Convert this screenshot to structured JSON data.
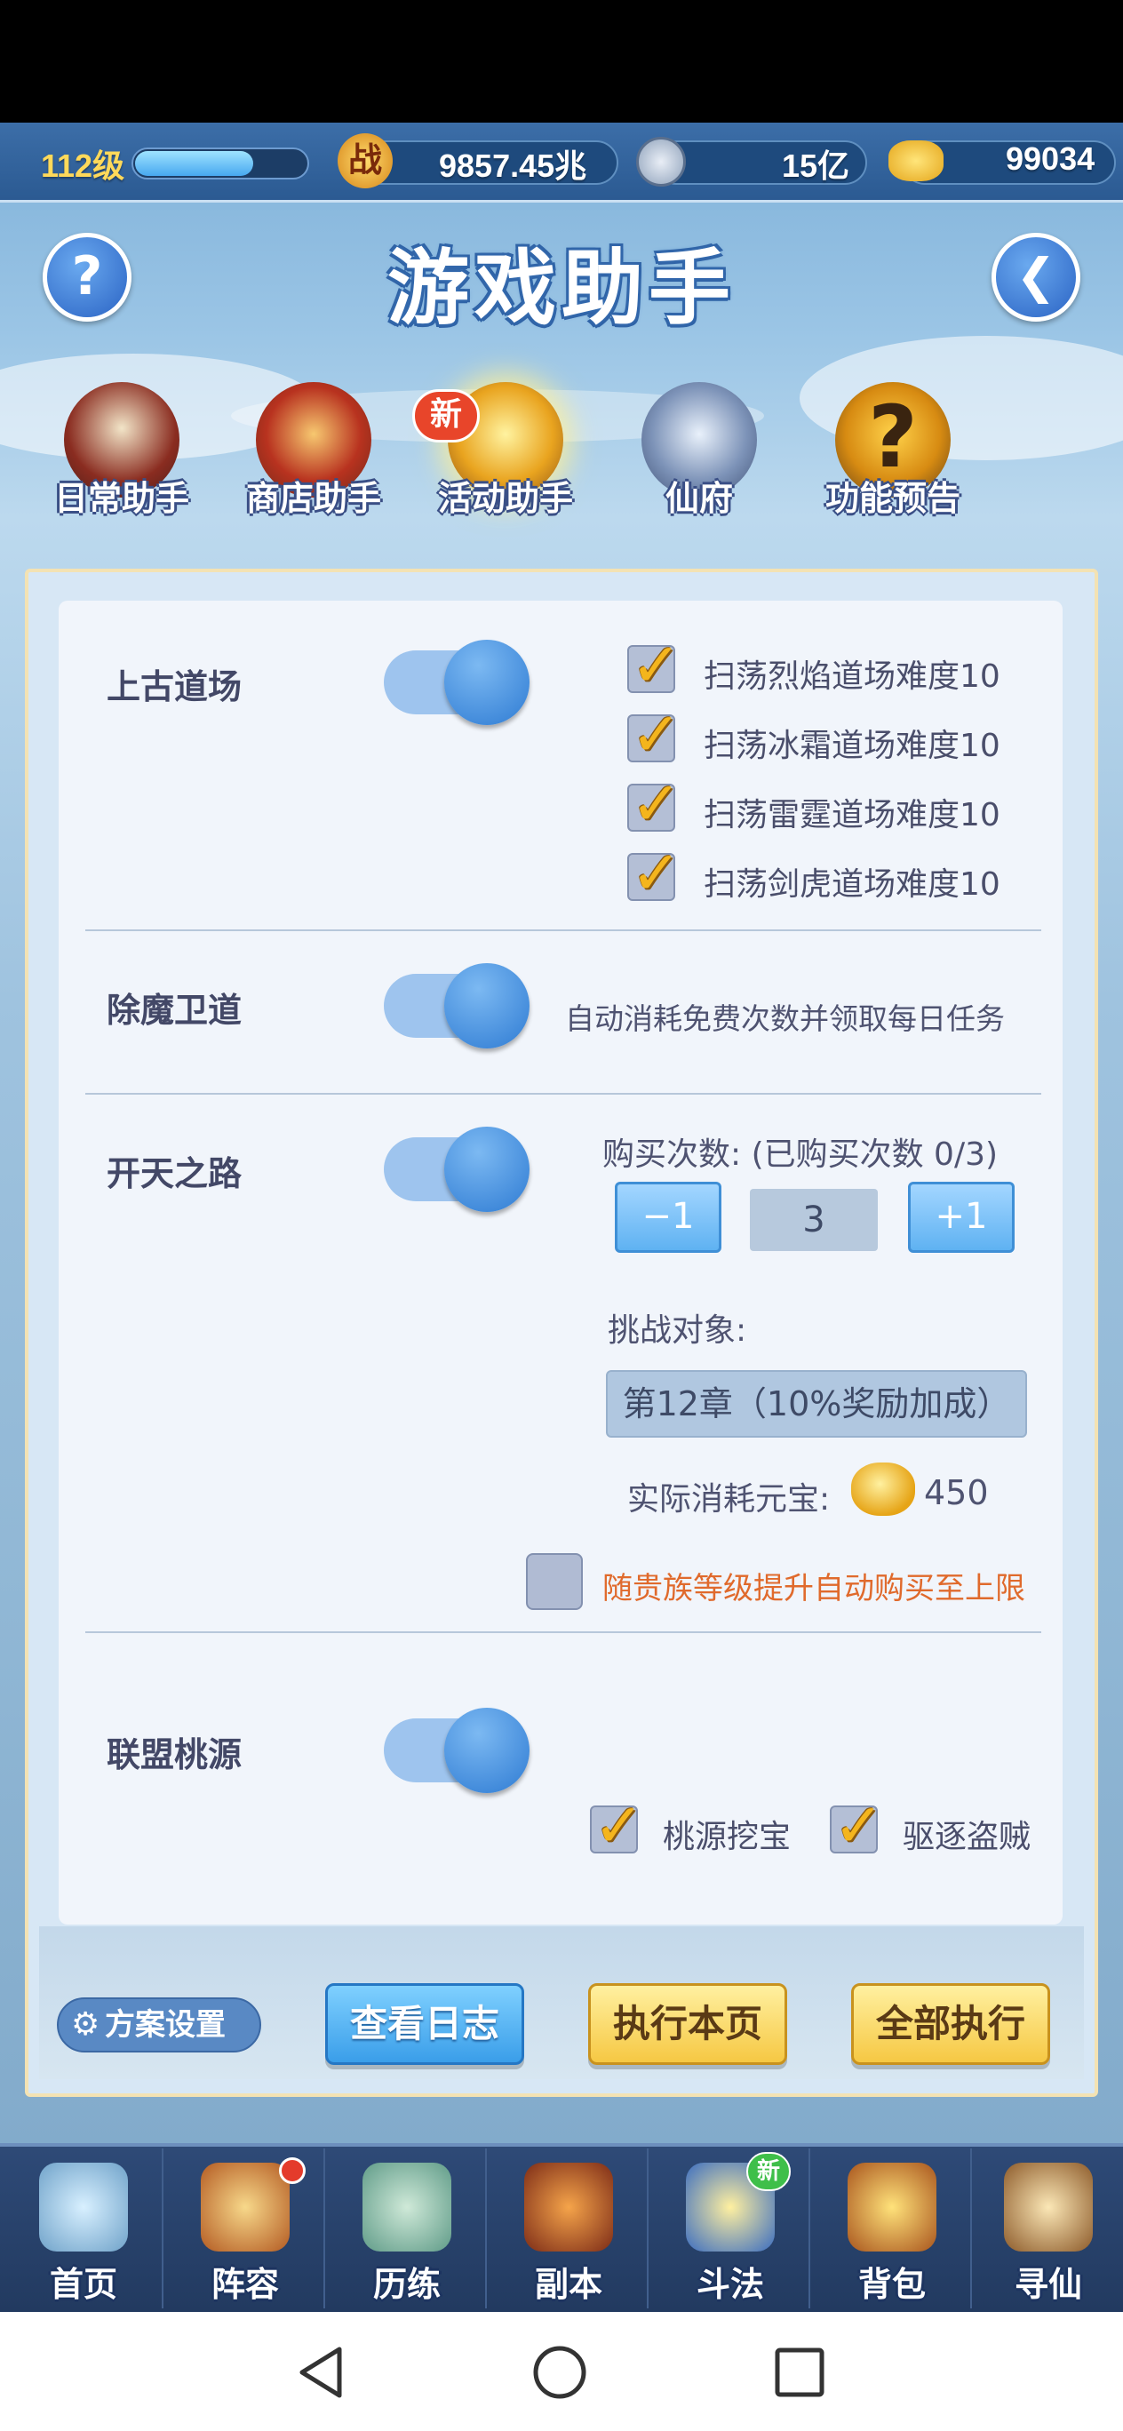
{
  "top_bar": {
    "level": "112级",
    "level_progress": 0.68,
    "power": "9857.45兆",
    "currency": "15亿",
    "gold": "99034"
  },
  "header": {
    "title": "游戏助手",
    "help_icon": "question-icon",
    "back_icon": "back-arrow-icon"
  },
  "tabs": [
    {
      "label": "日常助手",
      "icon": "scroll-icon"
    },
    {
      "label": "商店助手",
      "icon": "shop-icon"
    },
    {
      "label": "活动助手",
      "icon": "treasure-chest-icon",
      "badge": "新",
      "active": true
    },
    {
      "label": "仙府",
      "icon": "palace-icon"
    },
    {
      "label": "功能预告",
      "icon": "question-mark-icon"
    }
  ],
  "sections": {
    "ancient_dojo": {
      "title": "上古道场",
      "enabled": true,
      "options": [
        "扫荡烈焰道场难度10",
        "扫荡冰霜道场难度10",
        "扫荡雷霆道场难度10",
        "扫荡剑虎道场难度10"
      ]
    },
    "demon_guard": {
      "title": "除魔卫道",
      "enabled": true,
      "desc": "自动消耗免费次数并领取每日任务"
    },
    "sky_road": {
      "title": "开天之路",
      "enabled": true,
      "buy_label": "购买次数: (已购买次数 0/3)",
      "minus": "−1",
      "count": "3",
      "plus": "+1",
      "challenge_label": "挑战对象:",
      "challenge_value": "第12章（10%奖励加成）",
      "cost_label": "实际消耗元宝:",
      "cost_value": "450",
      "auto_buy_label": "随贵族等级提升自动购买至上限"
    },
    "alliance_peach": {
      "title": "联盟桃源",
      "enabled": true,
      "options": [
        "桃源挖宝",
        "驱逐盗贼"
      ]
    }
  },
  "actions": {
    "scheme": "方案设置",
    "view_log": "查看日志",
    "run_page": "执行本页",
    "run_all": "全部执行"
  },
  "nav": [
    {
      "label": "首页",
      "icon": "home-icon"
    },
    {
      "label": "阵容",
      "icon": "lineup-icon"
    },
    {
      "label": "历练",
      "icon": "training-icon"
    },
    {
      "label": "副本",
      "icon": "dungeon-icon"
    },
    {
      "label": "斗法",
      "icon": "battle-icon",
      "badge": "新"
    },
    {
      "label": "背包",
      "icon": "bag-icon"
    },
    {
      "label": "寻仙",
      "icon": "seek-icon"
    }
  ],
  "colors": {
    "accent_orange": "#e06a2c",
    "toggle_on": "#2e7bd3",
    "gold": "#f4b51d"
  }
}
